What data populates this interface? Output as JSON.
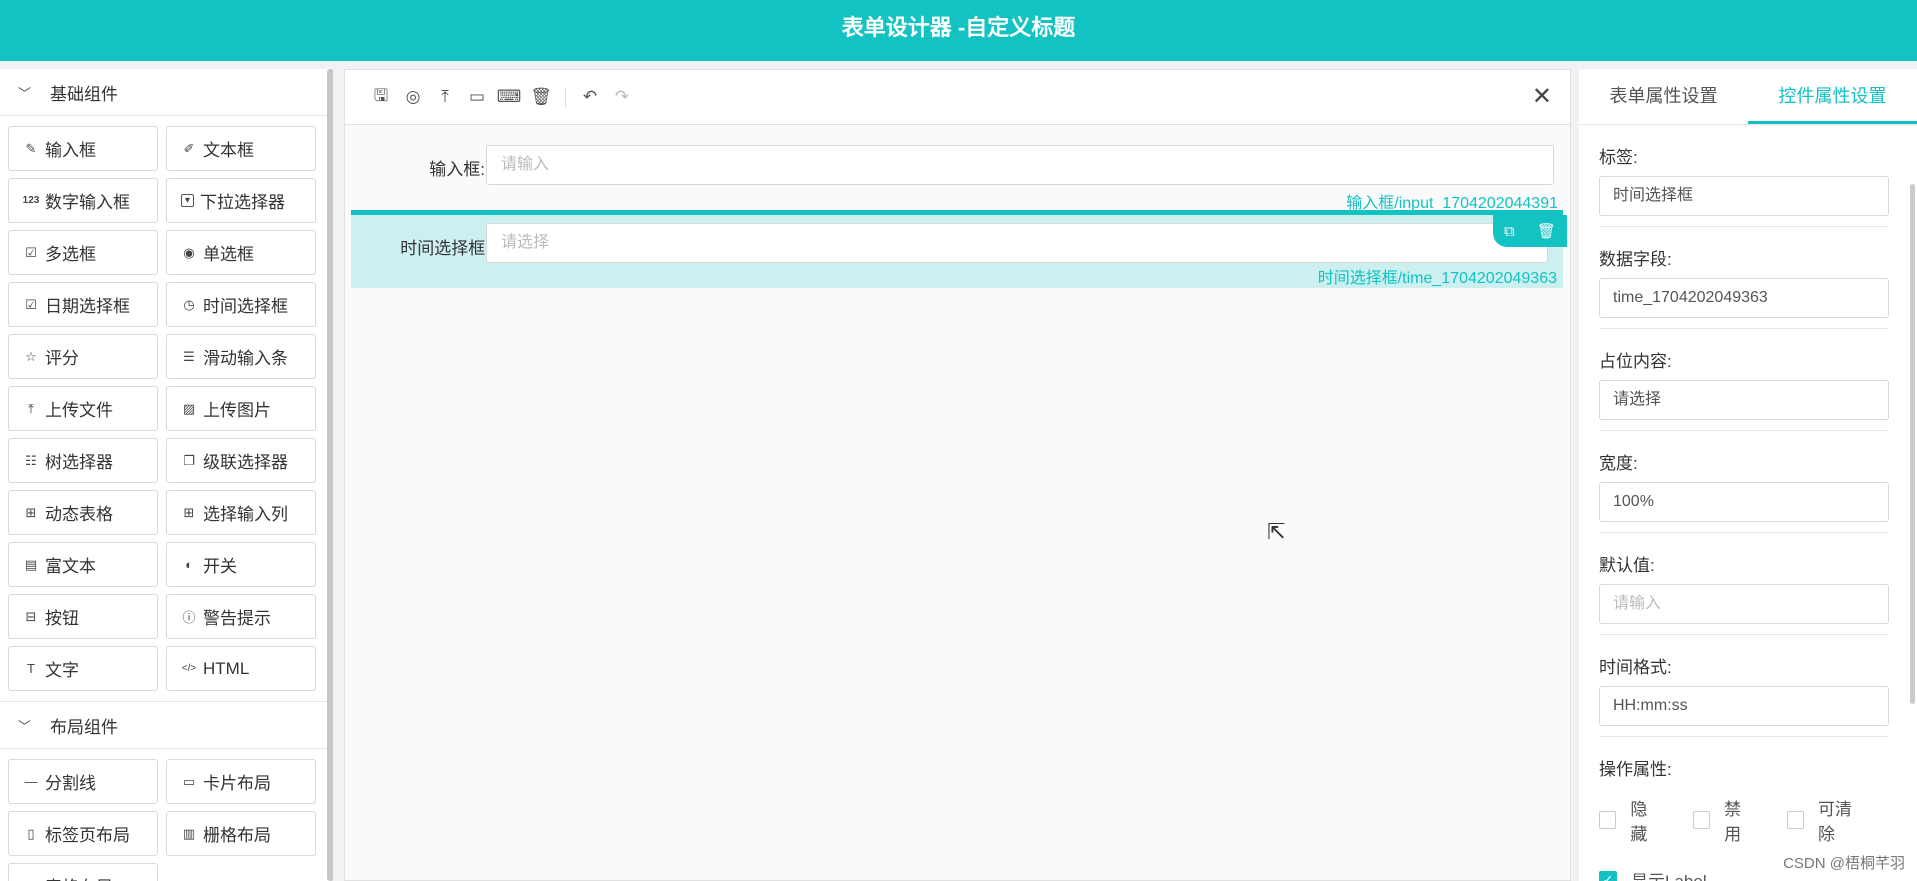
{
  "header": {
    "title": "表单设计器 -自定义标题"
  },
  "left": {
    "groups": [
      {
        "title": "基础组件",
        "items": [
          {
            "icon": "✎",
            "label": "输入框"
          },
          {
            "icon": "✐",
            "label": "文本框"
          },
          {
            "icon": "123",
            "label": "数字输入框"
          },
          {
            "icon": "▾",
            "label": "下拉选择器"
          },
          {
            "icon": "☑",
            "label": "多选框"
          },
          {
            "icon": "◉",
            "label": "单选框"
          },
          {
            "icon": "☑",
            "label": "日期选择框"
          },
          {
            "icon": "◷",
            "label": "时间选择框"
          },
          {
            "icon": "☆",
            "label": "评分"
          },
          {
            "icon": "☰",
            "label": "滑动输入条"
          },
          {
            "icon": "⤒",
            "label": "上传文件"
          },
          {
            "icon": "▨",
            "label": "上传图片"
          },
          {
            "icon": "☷",
            "label": "树选择器"
          },
          {
            "icon": "❐",
            "label": "级联选择器"
          },
          {
            "icon": "⊞",
            "label": "动态表格"
          },
          {
            "icon": "⊞",
            "label": "选择输入列"
          },
          {
            "icon": "▤",
            "label": "富文本"
          },
          {
            "icon": "◐",
            "label": "开关"
          },
          {
            "icon": "⊟",
            "label": "按钮"
          },
          {
            "icon": "ⓘ",
            "label": "警告提示"
          },
          {
            "icon": "T",
            "label": "文字"
          },
          {
            "icon": "</>",
            "label": "HTML"
          }
        ]
      },
      {
        "title": "布局组件",
        "items": [
          {
            "icon": "—",
            "label": "分割线"
          },
          {
            "icon": "▭",
            "label": "卡片布局"
          },
          {
            "icon": "▯",
            "label": "标签页布局"
          },
          {
            "icon": "▥",
            "label": "栅格布局"
          },
          {
            "icon": "▦",
            "label": "表格布局"
          }
        ]
      }
    ]
  },
  "canvas": {
    "fields": [
      {
        "label": "输入框:",
        "placeholder": "请输入",
        "id": "输入框/input_1704202044391"
      },
      {
        "label": "时间选择框:",
        "placeholder": "请选择",
        "id": "时间选择框/time_1704202049363"
      }
    ]
  },
  "right": {
    "tabs": [
      "表单属性设置",
      "控件属性设置"
    ],
    "props": [
      {
        "label": "标签:",
        "value": "时间选择框",
        "placeholder": false
      },
      {
        "label": "数据字段:",
        "value": "time_1704202049363",
        "placeholder": false
      },
      {
        "label": "占位内容:",
        "value": "请选择",
        "placeholder": false
      },
      {
        "label": "宽度:",
        "value": "100%",
        "placeholder": false
      },
      {
        "label": "默认值:",
        "value": "请输入",
        "placeholder": true
      },
      {
        "label": "时间格式:",
        "value": "HH:mm:ss",
        "placeholder": false
      }
    ],
    "ops_label": "操作属性:",
    "checks": [
      "隐藏",
      "禁用",
      "可清除"
    ],
    "show_label": "显示Label"
  },
  "watermark": "CSDN @梧桐芊羽",
  "colors": {
    "accent": "#13c2c2",
    "selected_bg": "#ccf0f0"
  }
}
